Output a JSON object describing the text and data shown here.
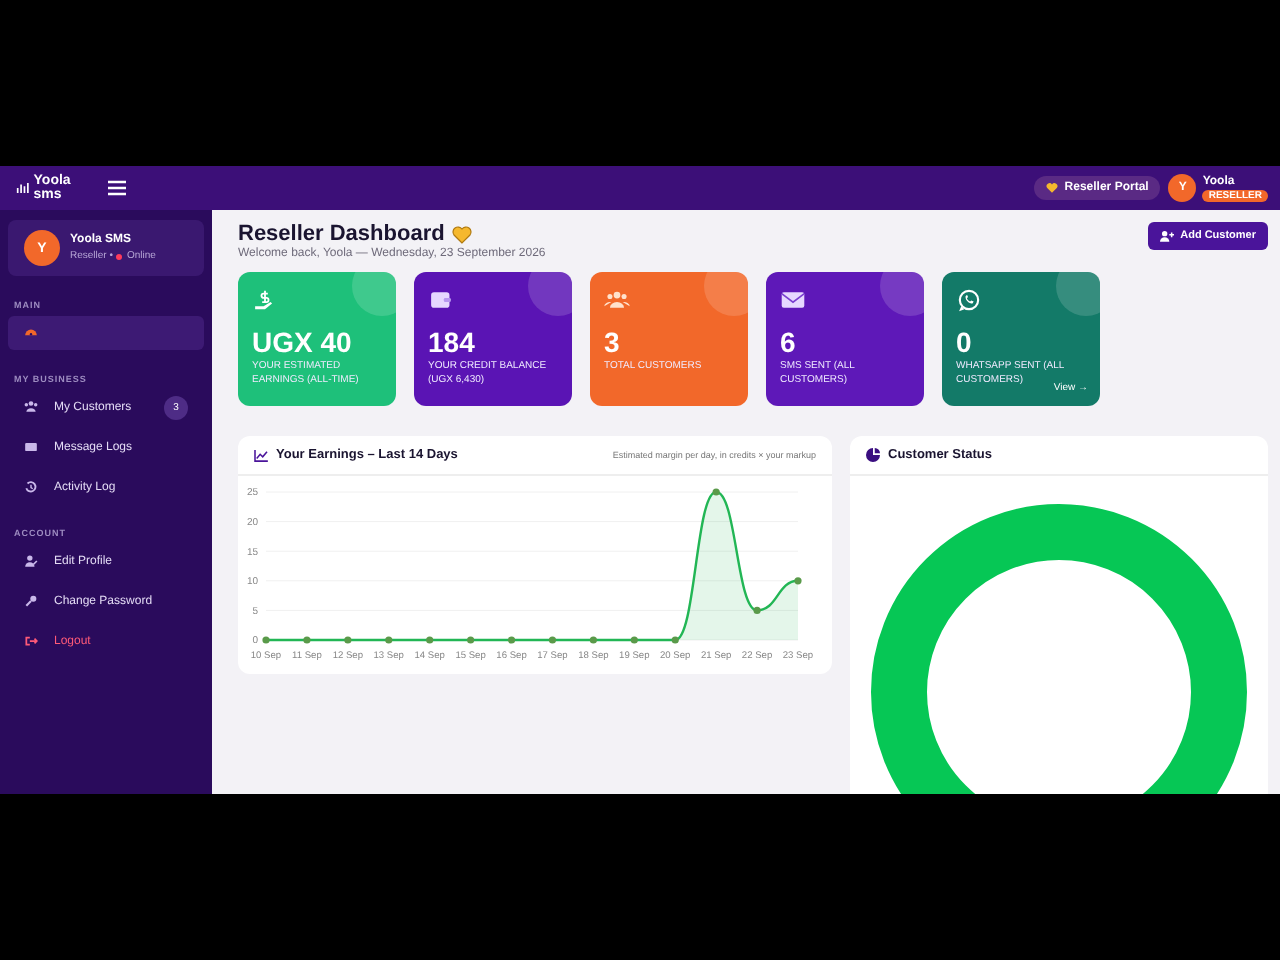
{
  "topbar": {
    "logo": "Yoola sms",
    "portal_button": "Reseller Portal",
    "user": {
      "avatar": "Y",
      "name": "Yoola",
      "role": "RESELLER"
    }
  },
  "sidebar": {
    "profile": {
      "avatar": "Y",
      "name": "Yoola SMS",
      "role": "Reseller •",
      "status": "Online"
    },
    "sections": [
      {
        "title": "MAIN",
        "items": [
          {
            "selected": true,
            "kind": "normal"
          }
        ]
      },
      {
        "title": "MY BUSINESS",
        "items": [
          {
            "label": "My Customers",
            "badge": "3",
            "selected": false,
            "kind": "normal"
          },
          {
            "label": "Message Logs",
            "selected": false,
            "kind": "normal"
          },
          {
            "label": "Activity Log",
            "selected": false,
            "kind": "normal"
          }
        ]
      },
      {
        "title": "ACCOUNT",
        "items": [
          {
            "label": "Edit Profile",
            "selected": false,
            "kind": "normal"
          },
          {
            "label": "Change Password",
            "selected": false,
            "kind": "normal"
          },
          {
            "label": "Logout",
            "selected": false,
            "kind": "danger"
          }
        ]
      }
    ]
  },
  "header": {
    "title": "Reseller Dashboard",
    "subtitle": "Welcome back, Yoola — Wednesday, 23 September 2026",
    "action": "Add Customer"
  },
  "stats": [
    {
      "value": "UGX 40",
      "label": "YOUR ESTIMATED EARNINGS (ALL-TIME)",
      "color": "#1ec07a"
    },
    {
      "value": "184",
      "label": "YOUR CREDIT BALANCE (UGX 6,430)",
      "color": "#5a14b4"
    },
    {
      "value": "3",
      "label": "TOTAL CUSTOMERS",
      "color": "#f2682a"
    },
    {
      "value": "6",
      "label": "SMS SENT (ALL CUSTOMERS)",
      "color": "#5e18b8"
    },
    {
      "value": "0",
      "label": "WHATSAPP SENT (ALL CUSTOMERS)",
      "color": "#137a68",
      "link": "View →"
    }
  ],
  "earnings": {
    "title": "Your Earnings – Last 14 Days",
    "note": "Estimated margin per day, in credits × your markup",
    "chart_data": {
      "type": "area",
      "categories": [
        "10 Sep",
        "11 Sep",
        "12 Sep",
        "13 Sep",
        "14 Sep",
        "15 Sep",
        "16 Sep",
        "17 Sep",
        "18 Sep",
        "19 Sep",
        "20 Sep",
        "21 Sep",
        "22 Sep",
        "23 Sep"
      ],
      "grid": true,
      "series": [
        {
          "color": "#22b655",
          "values": [
            0,
            0,
            0,
            0,
            0,
            0,
            0,
            0,
            0,
            0,
            0,
            25,
            5,
            10
          ]
        }
      ],
      "ylim": [
        0,
        25
      ],
      "yticks": [
        0,
        5,
        10,
        15,
        20,
        25
      ]
    }
  },
  "status": {
    "title": "Customer Status"
  }
}
